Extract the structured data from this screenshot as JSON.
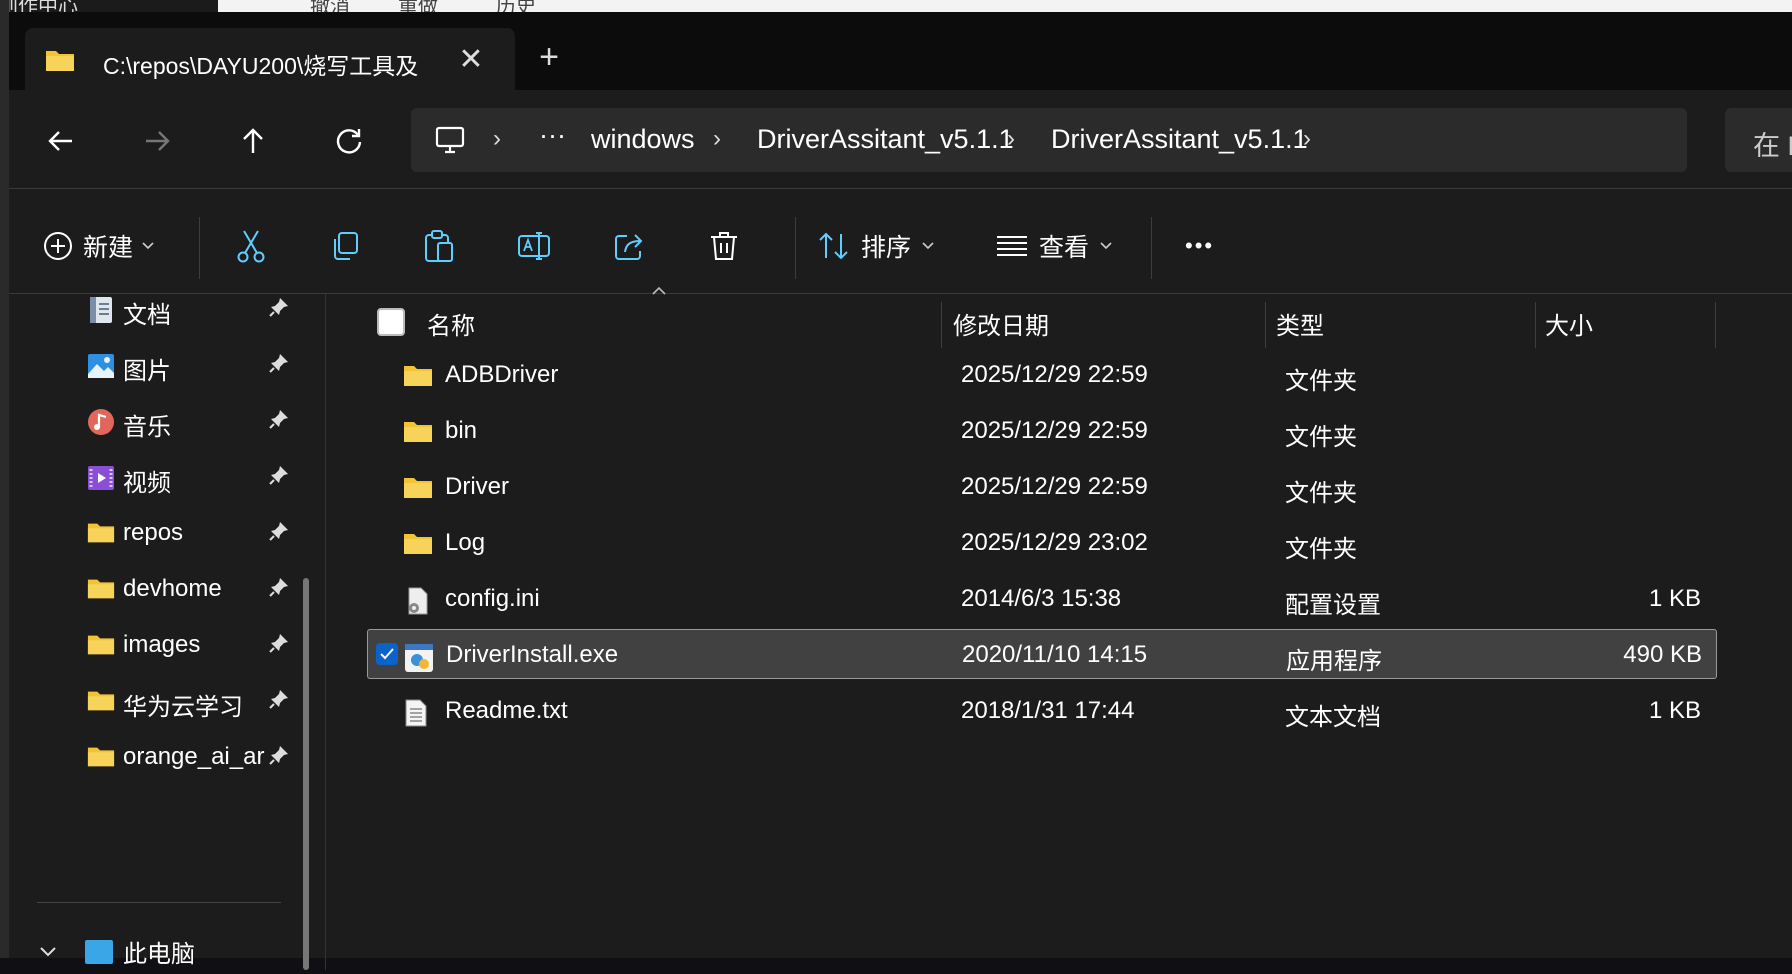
{
  "window": {
    "tab_title": "C:\\repos\\DAYU200\\烧写工具及",
    "tab_close": "✕",
    "new_tab": "+"
  },
  "background": {
    "left_title": "创作中心",
    "top_items": [
      "撤消",
      "重做",
      "历史"
    ]
  },
  "address": {
    "ellipsis": "···",
    "crumbs": [
      "windows",
      "DriverAssitant_v5.1.1",
      "DriverAssitant_v5.1.1"
    ],
    "search_prefix": "在 D"
  },
  "toolbar": {
    "new_label": "新建",
    "sort_label": "排序",
    "view_label": "查看",
    "more": "•••"
  },
  "sidebar": {
    "items": [
      {
        "label": "文档",
        "icon": "documents-icon"
      },
      {
        "label": "图片",
        "icon": "pictures-icon"
      },
      {
        "label": "音乐",
        "icon": "music-icon"
      },
      {
        "label": "视频",
        "icon": "videos-icon"
      },
      {
        "label": "repos",
        "icon": "folder-icon"
      },
      {
        "label": "devhome",
        "icon": "folder-icon"
      },
      {
        "label": "images",
        "icon": "folder-icon"
      },
      {
        "label": "华为云学习",
        "icon": "folder-icon"
      },
      {
        "label": "orange_ai_ar",
        "icon": "folder-icon"
      }
    ],
    "this_pc": "此电脑"
  },
  "columns": {
    "name": "名称",
    "date": "修改日期",
    "type": "类型",
    "size": "大小"
  },
  "files": [
    {
      "name": "ADBDriver",
      "date": "2025/12/29 22:59",
      "type": "文件夹",
      "size": "",
      "icon": "folder-icon"
    },
    {
      "name": "bin",
      "date": "2025/12/29 22:59",
      "type": "文件夹",
      "size": "",
      "icon": "folder-icon"
    },
    {
      "name": "Driver",
      "date": "2025/12/29 22:59",
      "type": "文件夹",
      "size": "",
      "icon": "folder-icon"
    },
    {
      "name": "Log",
      "date": "2025/12/29 23:02",
      "type": "文件夹",
      "size": "",
      "icon": "folder-icon"
    },
    {
      "name": "config.ini",
      "date": "2014/6/3 15:38",
      "type": "配置设置",
      "size": "1 KB",
      "icon": "settings-file-icon"
    },
    {
      "name": "DriverInstall.exe",
      "date": "2020/11/10 14:15",
      "type": "应用程序",
      "size": "490 KB",
      "icon": "exe-icon",
      "selected": true
    },
    {
      "name": "Readme.txt",
      "date": "2018/1/31 17:44",
      "type": "文本文档",
      "size": "1 KB",
      "icon": "text-file-icon"
    }
  ],
  "colors": {
    "folder": "#f2c335",
    "accent": "#0a63c9",
    "selection_bg": "#414141"
  }
}
